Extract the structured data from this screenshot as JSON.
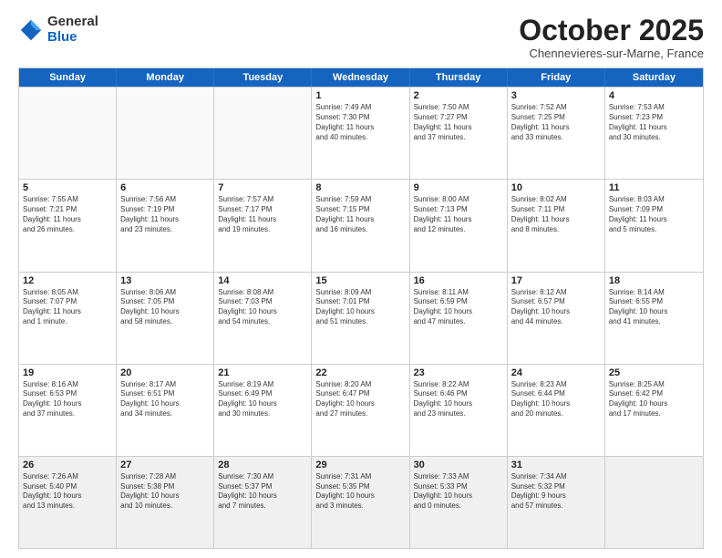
{
  "logo": {
    "general": "General",
    "blue": "Blue"
  },
  "title": "October 2025",
  "subtitle": "Chennevieres-sur-Marne, France",
  "days": [
    "Sunday",
    "Monday",
    "Tuesday",
    "Wednesday",
    "Thursday",
    "Friday",
    "Saturday"
  ],
  "rows": [
    [
      {
        "day": "",
        "empty": true,
        "lines": []
      },
      {
        "day": "",
        "empty": true,
        "lines": []
      },
      {
        "day": "",
        "empty": true,
        "lines": []
      },
      {
        "day": "1",
        "lines": [
          "Sunrise: 7:49 AM",
          "Sunset: 7:30 PM",
          "Daylight: 11 hours",
          "and 40 minutes."
        ]
      },
      {
        "day": "2",
        "lines": [
          "Sunrise: 7:50 AM",
          "Sunset: 7:27 PM",
          "Daylight: 11 hours",
          "and 37 minutes."
        ]
      },
      {
        "day": "3",
        "lines": [
          "Sunrise: 7:52 AM",
          "Sunset: 7:25 PM",
          "Daylight: 11 hours",
          "and 33 minutes."
        ]
      },
      {
        "day": "4",
        "lines": [
          "Sunrise: 7:53 AM",
          "Sunset: 7:23 PM",
          "Daylight: 11 hours",
          "and 30 minutes."
        ]
      }
    ],
    [
      {
        "day": "5",
        "lines": [
          "Sunrise: 7:55 AM",
          "Sunset: 7:21 PM",
          "Daylight: 11 hours",
          "and 26 minutes."
        ]
      },
      {
        "day": "6",
        "lines": [
          "Sunrise: 7:56 AM",
          "Sunset: 7:19 PM",
          "Daylight: 11 hours",
          "and 23 minutes."
        ]
      },
      {
        "day": "7",
        "lines": [
          "Sunrise: 7:57 AM",
          "Sunset: 7:17 PM",
          "Daylight: 11 hours",
          "and 19 minutes."
        ]
      },
      {
        "day": "8",
        "lines": [
          "Sunrise: 7:59 AM",
          "Sunset: 7:15 PM",
          "Daylight: 11 hours",
          "and 16 minutes."
        ]
      },
      {
        "day": "9",
        "lines": [
          "Sunrise: 8:00 AM",
          "Sunset: 7:13 PM",
          "Daylight: 11 hours",
          "and 12 minutes."
        ]
      },
      {
        "day": "10",
        "lines": [
          "Sunrise: 8:02 AM",
          "Sunset: 7:11 PM",
          "Daylight: 11 hours",
          "and 8 minutes."
        ]
      },
      {
        "day": "11",
        "lines": [
          "Sunrise: 8:03 AM",
          "Sunset: 7:09 PM",
          "Daylight: 11 hours",
          "and 5 minutes."
        ]
      }
    ],
    [
      {
        "day": "12",
        "lines": [
          "Sunrise: 8:05 AM",
          "Sunset: 7:07 PM",
          "Daylight: 11 hours",
          "and 1 minute."
        ]
      },
      {
        "day": "13",
        "lines": [
          "Sunrise: 8:06 AM",
          "Sunset: 7:05 PM",
          "Daylight: 10 hours",
          "and 58 minutes."
        ]
      },
      {
        "day": "14",
        "lines": [
          "Sunrise: 8:08 AM",
          "Sunset: 7:03 PM",
          "Daylight: 10 hours",
          "and 54 minutes."
        ]
      },
      {
        "day": "15",
        "lines": [
          "Sunrise: 8:09 AM",
          "Sunset: 7:01 PM",
          "Daylight: 10 hours",
          "and 51 minutes."
        ]
      },
      {
        "day": "16",
        "lines": [
          "Sunrise: 8:11 AM",
          "Sunset: 6:59 PM",
          "Daylight: 10 hours",
          "and 47 minutes."
        ]
      },
      {
        "day": "17",
        "lines": [
          "Sunrise: 8:12 AM",
          "Sunset: 6:57 PM",
          "Daylight: 10 hours",
          "and 44 minutes."
        ]
      },
      {
        "day": "18",
        "lines": [
          "Sunrise: 8:14 AM",
          "Sunset: 6:55 PM",
          "Daylight: 10 hours",
          "and 41 minutes."
        ]
      }
    ],
    [
      {
        "day": "19",
        "lines": [
          "Sunrise: 8:16 AM",
          "Sunset: 6:53 PM",
          "Daylight: 10 hours",
          "and 37 minutes."
        ]
      },
      {
        "day": "20",
        "lines": [
          "Sunrise: 8:17 AM",
          "Sunset: 6:51 PM",
          "Daylight: 10 hours",
          "and 34 minutes."
        ]
      },
      {
        "day": "21",
        "lines": [
          "Sunrise: 8:19 AM",
          "Sunset: 6:49 PM",
          "Daylight: 10 hours",
          "and 30 minutes."
        ]
      },
      {
        "day": "22",
        "lines": [
          "Sunrise: 8:20 AM",
          "Sunset: 6:47 PM",
          "Daylight: 10 hours",
          "and 27 minutes."
        ]
      },
      {
        "day": "23",
        "lines": [
          "Sunrise: 8:22 AM",
          "Sunset: 6:46 PM",
          "Daylight: 10 hours",
          "and 23 minutes."
        ]
      },
      {
        "day": "24",
        "lines": [
          "Sunrise: 8:23 AM",
          "Sunset: 6:44 PM",
          "Daylight: 10 hours",
          "and 20 minutes."
        ]
      },
      {
        "day": "25",
        "lines": [
          "Sunrise: 8:25 AM",
          "Sunset: 6:42 PM",
          "Daylight: 10 hours",
          "and 17 minutes."
        ]
      }
    ],
    [
      {
        "day": "26",
        "lines": [
          "Sunrise: 7:26 AM",
          "Sunset: 5:40 PM",
          "Daylight: 10 hours",
          "and 13 minutes."
        ],
        "last": true
      },
      {
        "day": "27",
        "lines": [
          "Sunrise: 7:28 AM",
          "Sunset: 5:38 PM",
          "Daylight: 10 hours",
          "and 10 minutes."
        ],
        "last": true
      },
      {
        "day": "28",
        "lines": [
          "Sunrise: 7:30 AM",
          "Sunset: 5:37 PM",
          "Daylight: 10 hours",
          "and 7 minutes."
        ],
        "last": true
      },
      {
        "day": "29",
        "lines": [
          "Sunrise: 7:31 AM",
          "Sunset: 5:35 PM",
          "Daylight: 10 hours",
          "and 3 minutes."
        ],
        "last": true
      },
      {
        "day": "30",
        "lines": [
          "Sunrise: 7:33 AM",
          "Sunset: 5:33 PM",
          "Daylight: 10 hours",
          "and 0 minutes."
        ],
        "last": true
      },
      {
        "day": "31",
        "lines": [
          "Sunrise: 7:34 AM",
          "Sunset: 5:32 PM",
          "Daylight: 9 hours",
          "and 57 minutes."
        ],
        "last": true
      },
      {
        "day": "",
        "empty": true,
        "last": true,
        "lines": []
      }
    ]
  ]
}
